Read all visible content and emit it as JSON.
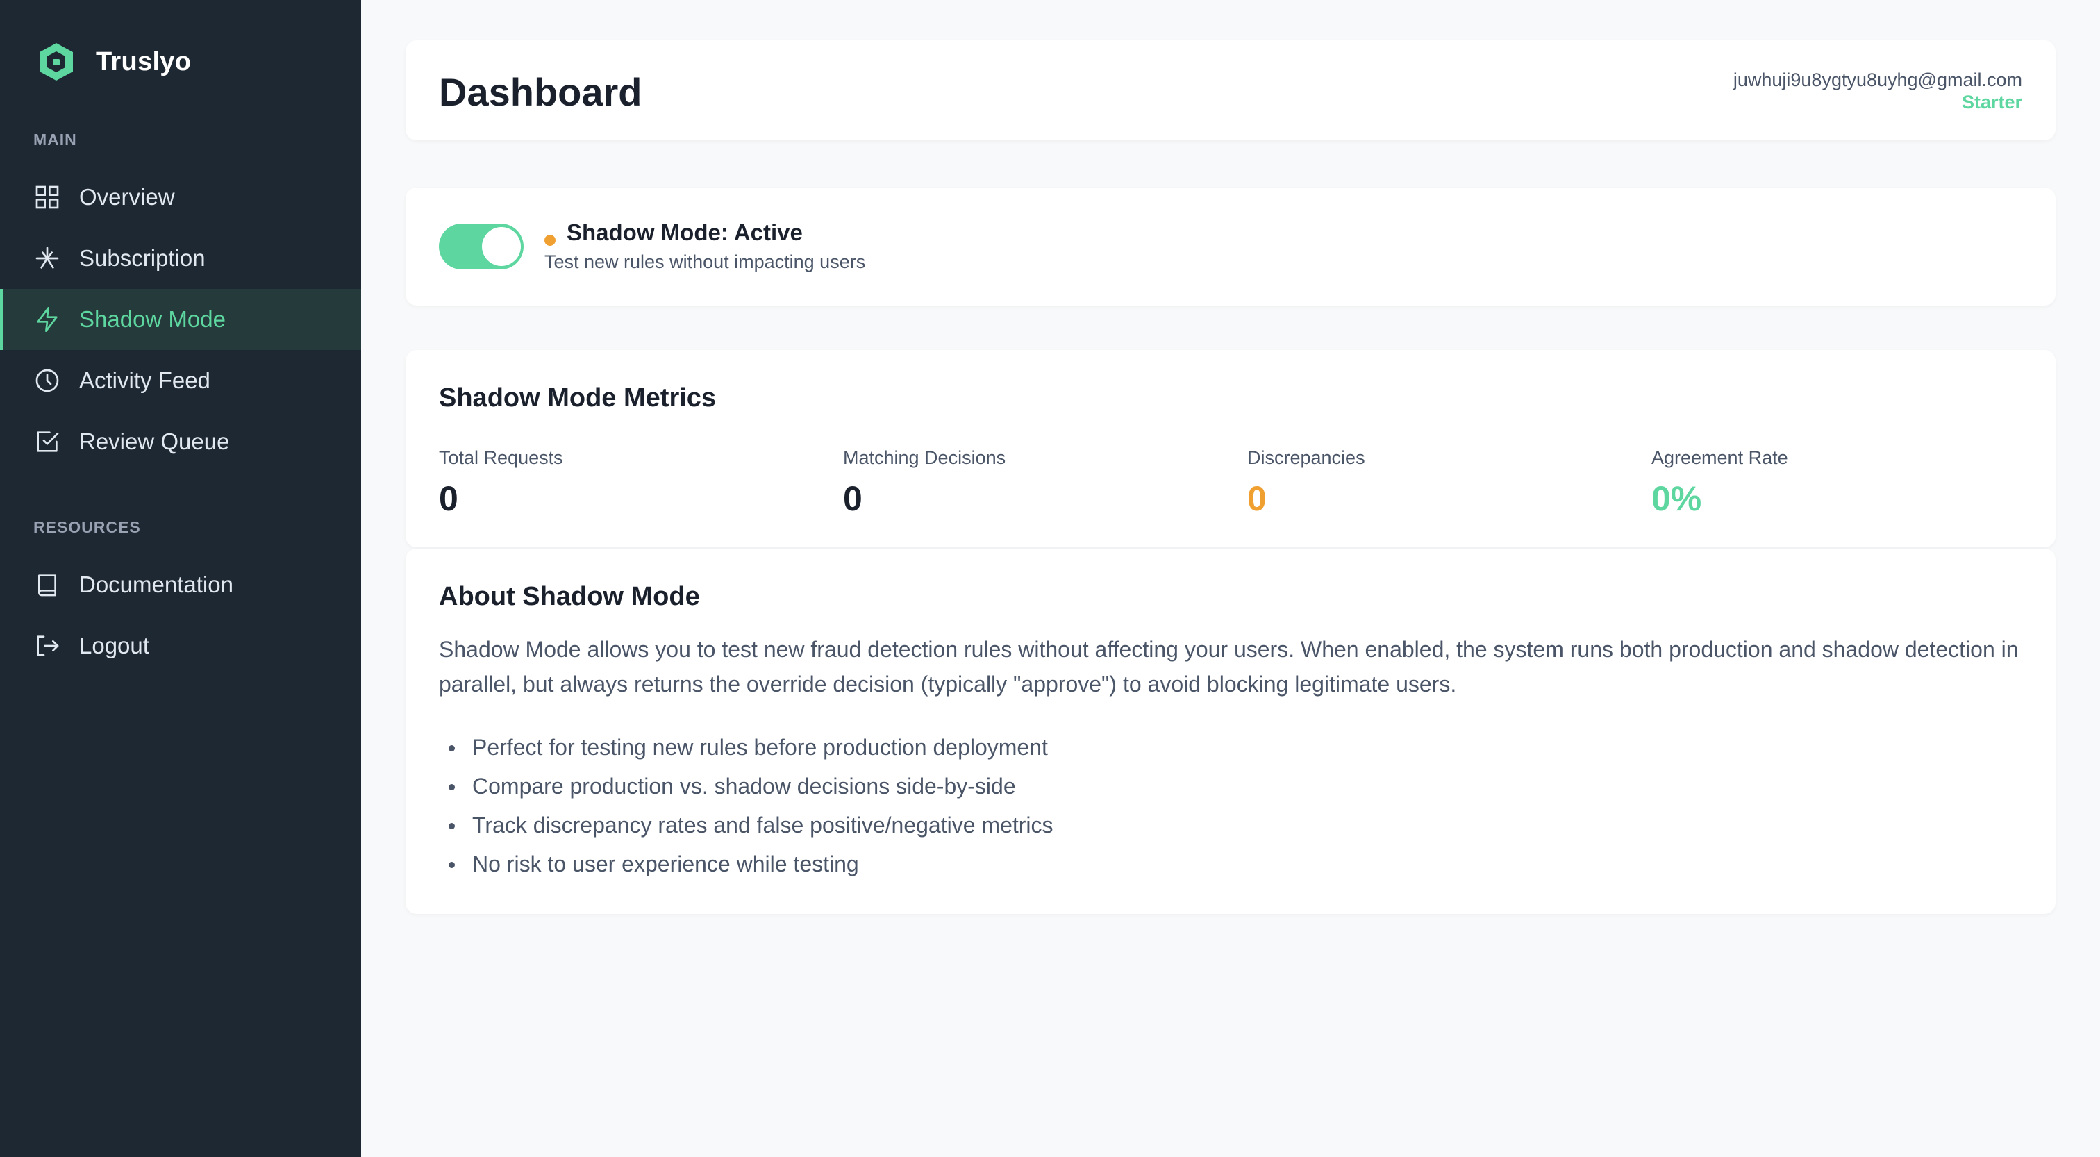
{
  "brand": {
    "name": "Truslyo",
    "accent": "#5dd6a0"
  },
  "sidebar": {
    "section_main": "MAIN",
    "section_resources": "RESOURCES",
    "items": [
      {
        "label": "Overview",
        "icon": "grid-icon"
      },
      {
        "label": "Subscription",
        "icon": "subscription-icon"
      },
      {
        "label": "Shadow Mode",
        "icon": "lightning-icon",
        "active": true
      },
      {
        "label": "Activity Feed",
        "icon": "clock-icon"
      },
      {
        "label": "Review Queue",
        "icon": "checkbox-icon"
      }
    ],
    "resources": [
      {
        "label": "Documentation",
        "icon": "book-icon"
      },
      {
        "label": "Logout",
        "icon": "logout-icon"
      }
    ]
  },
  "header": {
    "title": "Dashboard",
    "email": "juwhuji9u8ygtyu8uyhg@gmail.com",
    "plan": "Starter"
  },
  "shadow_toggle": {
    "enabled": true,
    "status_title": "Shadow Mode: Active",
    "status_subtitle": "Test new rules without impacting users",
    "dot_color": "#f0a030"
  },
  "metrics": {
    "title": "Shadow Mode Metrics",
    "items": [
      {
        "label": "Total Requests",
        "value": "0"
      },
      {
        "label": "Matching Decisions",
        "value": "0"
      },
      {
        "label": "Discrepancies",
        "value": "0",
        "color": "#f0a030"
      },
      {
        "label": "Agreement Rate",
        "value": "0%",
        "color": "#5dd6a0"
      }
    ]
  },
  "about": {
    "title": "About Shadow Mode",
    "description": "Shadow Mode allows you to test new fraud detection rules without affecting your users. When enabled, the system runs both production and shadow detection in parallel, but always returns the override decision (typically \"approve\") to avoid blocking legitimate users.",
    "bullets": [
      "Perfect for testing new rules before production deployment",
      "Compare production vs. shadow decisions side-by-side",
      "Track discrepancy rates and false positive/negative metrics",
      "No risk to user experience while testing"
    ]
  }
}
